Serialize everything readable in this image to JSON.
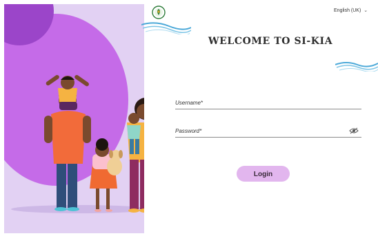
{
  "header": {
    "language": "English (UK)",
    "language_icon": "chevron-down-icon"
  },
  "main": {
    "title": "WELCOME TO SI-KIA",
    "username_label": "Username*",
    "password_label": "Password*",
    "password_icon": "eye-icon",
    "login_label": "Login"
  },
  "colors": {
    "panel_bg": "#e2d1f3",
    "circle": "#c56be8",
    "accent_dark": "#9b45c9",
    "button": "#e2b6ee",
    "wave": "#4aa8d8"
  }
}
